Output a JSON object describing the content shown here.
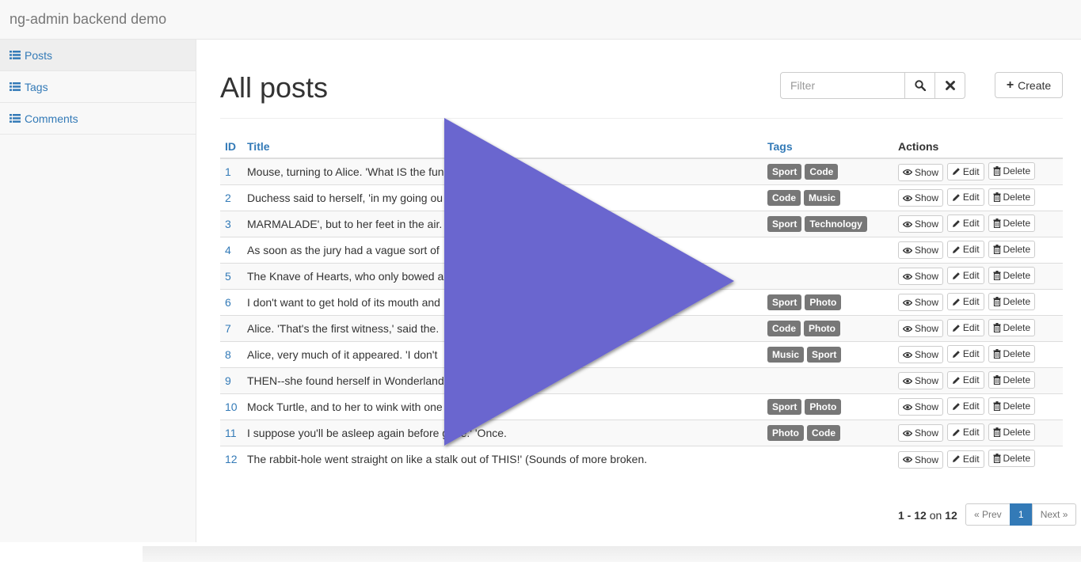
{
  "navbar": {
    "brand": "ng-admin backend demo"
  },
  "sidebar": {
    "items": [
      {
        "label": "Posts",
        "icon": "list-icon",
        "active": true
      },
      {
        "label": "Tags",
        "icon": "list-icon",
        "active": false
      },
      {
        "label": "Comments",
        "icon": "list-icon",
        "active": false
      }
    ]
  },
  "main": {
    "title": "All posts",
    "filter": {
      "placeholder": "Filter",
      "search_icon": "search-icon",
      "clear_icon": "close-icon"
    },
    "create_label": "Create"
  },
  "table": {
    "headers": {
      "id": "ID",
      "title": "Title",
      "tags": "Tags",
      "actions": "Actions"
    },
    "action_labels": {
      "show": "Show",
      "edit": "Edit",
      "delete": "Delete"
    },
    "rows": [
      {
        "id": "1",
        "title": "Mouse, turning to Alice. 'What IS the fun",
        "tags": [
          "Sport",
          "Code"
        ]
      },
      {
        "id": "2",
        "title": "Duchess said to herself, 'in my going ou",
        "tags": [
          "Code",
          "Music"
        ]
      },
      {
        "id": "3",
        "title": "MARMALADE', but to her feet in the air.                                       ouse began.",
        "tags": [
          "Sport",
          "Technology"
        ]
      },
      {
        "id": "4",
        "title": "As soon as the jury had a vague sort of",
        "tags": []
      },
      {
        "id": "5",
        "title": "The Knave of Hearts, who only bowed a",
        "tags": []
      },
      {
        "id": "6",
        "title": "I don't want to get hold of its mouth and",
        "tags": [
          "Sport",
          "Photo"
        ]
      },
      {
        "id": "7",
        "title": "Alice. 'That's the first witness,' said the.",
        "tags": [
          "Code",
          "Photo"
        ]
      },
      {
        "id": "8",
        "title": "Alice, very much of it appeared. 'I don't",
        "tags": [
          "Music",
          "Sport"
        ]
      },
      {
        "id": "9",
        "title": "THEN--she found herself in Wonderland                                had gone through.",
        "tags": []
      },
      {
        "id": "10",
        "title": "Mock Turtle, and to her to wink with one                    to put.",
        "tags": [
          "Sport",
          "Photo"
        ]
      },
      {
        "id": "11",
        "title": "I suppose you'll be asleep again before               gone.' 'Once.",
        "tags": [
          "Photo",
          "Code"
        ]
      },
      {
        "id": "12",
        "title": "The rabbit-hole went straight on like a stalk out of THIS!' (Sounds of more broken.",
        "tags": []
      }
    ]
  },
  "pagination": {
    "range": "1 - 12",
    "connector": "on",
    "total": "12",
    "prev_label": "« Prev",
    "current_page": "1",
    "next_label": "Next »"
  },
  "overlay": {
    "icon": "play-icon",
    "color": "#6b66cf"
  }
}
